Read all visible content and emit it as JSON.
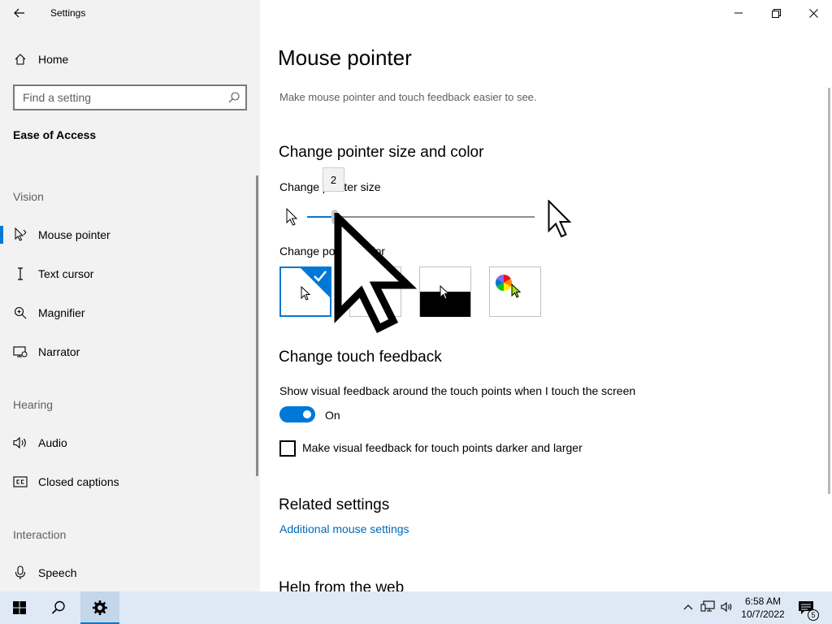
{
  "window": {
    "title": "Settings"
  },
  "sidebar": {
    "home_label": "Home",
    "search_placeholder": "Find a setting",
    "category": "Ease of Access",
    "vision_header": "Vision",
    "hearing_header": "Hearing",
    "interaction_header": "Interaction",
    "items": [
      {
        "label": "Mouse pointer",
        "icon": "mouse-pointer-icon",
        "active": true
      },
      {
        "label": "Text cursor",
        "icon": "text-cursor-icon"
      },
      {
        "label": "Magnifier",
        "icon": "magnifier-icon"
      },
      {
        "label": "Narrator",
        "icon": "narrator-icon"
      },
      {
        "label": "Audio",
        "icon": "speaker-icon"
      },
      {
        "label": "Closed captions",
        "icon": "closed-captions-icon"
      },
      {
        "label": "Speech",
        "icon": "microphone-icon"
      }
    ]
  },
  "main": {
    "title": "Mouse pointer",
    "description": "Make mouse pointer and touch feedback easier to see.",
    "section_size_color": "Change pointer size and color",
    "size_label": "Change pointer size",
    "size_value": "2",
    "size_value_fraction": 0.12,
    "color_label": "Change pointer color",
    "color_options": [
      {
        "name": "white",
        "selected": true
      },
      {
        "name": "black"
      },
      {
        "name": "inverted"
      },
      {
        "name": "custom"
      }
    ],
    "section_touch": "Change touch feedback",
    "touch_label": "Show visual feedback around the touch points when I touch the screen",
    "toggle_state": "On",
    "darker_label": "Make visual feedback for touch points darker and larger",
    "section_related": "Related settings",
    "related_link": "Additional mouse settings",
    "section_help": "Help from the web"
  },
  "taskbar": {
    "time": "6:58 AM",
    "date": "10/7/2022",
    "notification_count": "5"
  },
  "colors": {
    "accent": "#0078d7",
    "sidebar_bg": "#f2f2f2",
    "taskbar_bg": "#dfe9f5",
    "link": "#0067b8"
  }
}
